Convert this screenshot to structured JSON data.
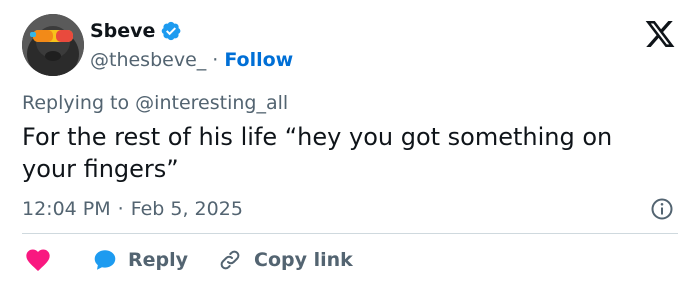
{
  "author": {
    "display_name": "Sbeve",
    "handle": "@thesbeve_",
    "follow_label": "Follow",
    "verified": true
  },
  "reply_context": {
    "prefix": "Replying to",
    "mention": "@interesting_all"
  },
  "tweet": {
    "text": "For the rest of his life “hey you got something on your fingers”",
    "time": "12:04 PM",
    "date": "Feb 5, 2025"
  },
  "actions": {
    "reply_label": "Reply",
    "copy_link_label": "Copy link"
  },
  "icons": {
    "verified": "verified-badge-icon",
    "logo": "x-logo-icon",
    "info": "info-icon",
    "like": "heart-icon",
    "reply": "speech-bubble-icon",
    "copy": "link-icon"
  },
  "colors": {
    "text_primary": "#0f1419",
    "text_secondary": "#536471",
    "follow": "#006fd6",
    "verified": "#1d9bf0",
    "like": "#f91880",
    "reply": "#1d9bf0",
    "divider": "#cfd9de"
  }
}
